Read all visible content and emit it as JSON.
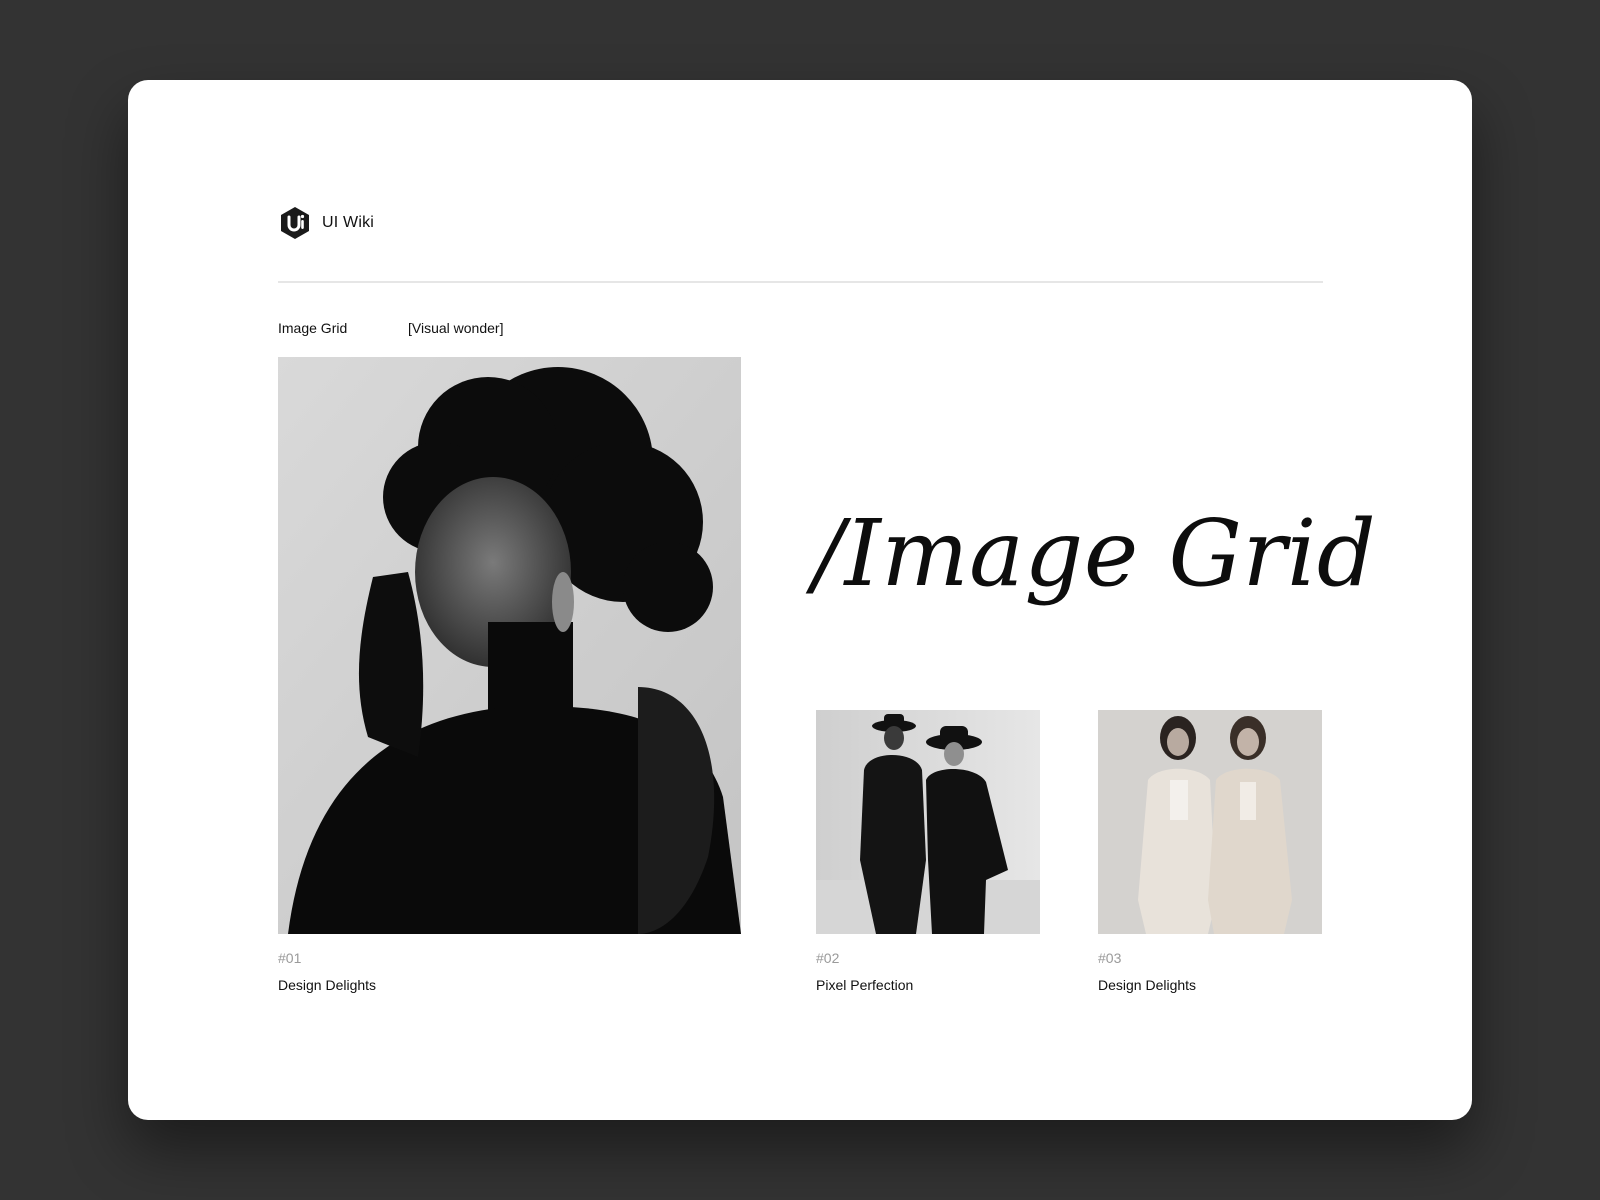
{
  "brand": {
    "name": "UI Wiki",
    "logo_icon": "ui-hexagon-logo-icon"
  },
  "section": {
    "label": "Image Grid",
    "tag": "[Visual wonder]"
  },
  "headline": "/Image Grid",
  "items": [
    {
      "number": "#01",
      "caption": "Design Delights",
      "image": "portrait-woman-afro-photo"
    },
    {
      "number": "#02",
      "caption": "Pixel Perfection",
      "image": "two-men-in-hats-photo"
    },
    {
      "number": "#03",
      "caption": "Design Delights",
      "image": "two-women-in-beige-photo"
    }
  ],
  "colors": {
    "background": "#333333",
    "card": "#ffffff",
    "text": "#111111",
    "muted": "#9a9a9a",
    "divider": "#e6e6e6"
  }
}
